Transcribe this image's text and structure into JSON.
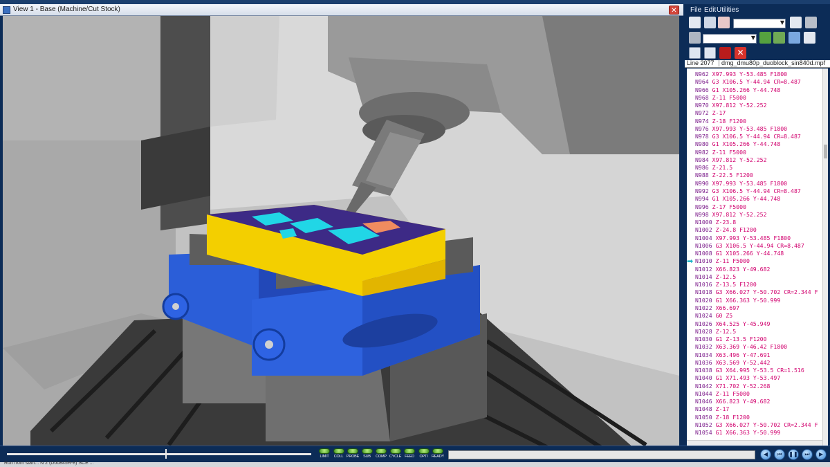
{
  "viewport": {
    "title": "View 1 - Base (Machine/Cut Stock)",
    "close_icon": "close-icon"
  },
  "panel": {
    "menu": [
      "File",
      "Edit",
      "Utilities"
    ],
    "line_indicator": "Line 2077",
    "program_file": "dmg_dmu80p_duoblock_sin840d.mpf",
    "current_line_index": 24,
    "code_lines": [
      "N962 X97.993 Y-53.485 F1800",
      "N964 G3 X106.5 Y-44.94 CR=8.487",
      "N966 G1 X105.266 Y-44.748",
      "N968 Z-11 F5000",
      "N970 X97.812 Y-52.252",
      "N972 Z-17",
      "N974 Z-18 F1200",
      "N976 X97.993 Y-53.485 F1800",
      "N978 G3 X106.5 Y-44.94 CR=8.487",
      "N980 G1 X105.266 Y-44.748",
      "N982 Z-11 F5000",
      "N984 X97.812 Y-52.252",
      "N986 Z-21.5",
      "N988 Z-22.5 F1200",
      "N990 X97.993 Y-53.485 F1800",
      "N992 G3 X106.5 Y-44.94 CR=8.487",
      "N994 G1 X105.266 Y-44.748",
      "N996 Z-17 F5000",
      "N998 X97.812 Y-52.252",
      "N1000 Z-23.8",
      "N1002 Z-24.8 F1200",
      "N1004 X97.993 Y-53.485 F1800",
      "N1006 G3 X106.5 Y-44.94 CR=8.487",
      "N1008 G1 X105.266 Y-44.748",
      "N1010 Z-11 F5000",
      "N1012 X66.823 Y-49.682",
      "N1014 Z-12.5",
      "N1016 Z-13.5 F1200",
      "N1018 G3 X66.027 Y-50.702 CR=2.344 F",
      "N1020 G1 X66.363 Y-50.999",
      "N1022 X66.697",
      "N1024 G0 Z5",
      "N1026 X64.525 Y-45.949",
      "N1028 Z-12.5",
      "N1030 G1 Z-13.5 F1200",
      "N1032 X63.369 Y-46.42 F1800",
      "N1034 X63.496 Y-47.691",
      "N1036 X63.569 Y-52.442",
      "N1038 G3 X64.995 Y-53.5 CR=1.516",
      "N1040 G1 X71.493 Y-53.497",
      "N1042 X71.702 Y-52.268",
      "N1044 Z-11 F5000",
      "N1046 X66.823 Y-49.682",
      "N1048 Z-17",
      "N1050 Z-18 F1200",
      "N1052 G3 X66.027 Y-50.702 CR=2.344 F",
      "N1054 G1 X66.363 Y-50.999"
    ]
  },
  "indicators": [
    "LIMIT",
    "COLL",
    "PROBE",
    "SUB",
    "COMP",
    "CYCLE",
    "FEED",
    "OPTI",
    "READY"
  ],
  "playback": {
    "timeline_position": 0.52,
    "buttons": [
      "play-reverse-icon",
      "rewind-icon",
      "pause-icon",
      "step-forward-icon",
      "play-icon"
    ]
  },
  "status": {
    "text": "Run from start... N 2 (D00845R-8)  SCE ..."
  },
  "colors": {
    "accent": "#0c2c57",
    "fixture_blue": "#2b5ed8",
    "stock_yellow": "#f3cf00",
    "stock_top": "#3d2a86",
    "cut_cyan": "#21d6e6",
    "code_pink": "#d1006e"
  }
}
